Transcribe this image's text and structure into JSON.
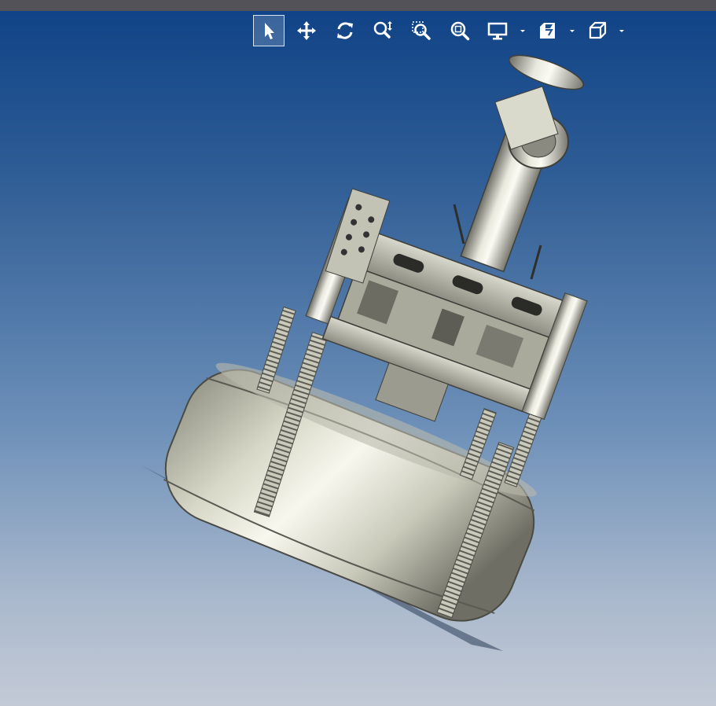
{
  "colors": {
    "background_top": "#0e4186",
    "background_bottom": "#c3cad6",
    "topbar": "#525258",
    "icon": "#ffffff"
  },
  "toolbar": {
    "tools": [
      {
        "name": "select",
        "icon": "arrow-pointer-icon",
        "active": true
      },
      {
        "name": "pan",
        "icon": "move-arrows-icon",
        "active": false
      },
      {
        "name": "rotate",
        "icon": "rotate-icon",
        "active": false
      },
      {
        "name": "zoom-in-out",
        "icon": "zoom-in-out-icon",
        "active": false
      },
      {
        "name": "zoom-area",
        "icon": "zoom-area-icon",
        "active": false
      },
      {
        "name": "zoom-to-fit",
        "icon": "zoom-fit-icon",
        "active": false
      },
      {
        "name": "display-style",
        "icon": "monitor-icon",
        "active": false,
        "dropdown": true
      },
      {
        "name": "section-view",
        "icon": "section-view-icon",
        "active": false,
        "dropdown": true
      },
      {
        "name": "view-orientation",
        "icon": "cube-icon",
        "active": false,
        "dropdown": true
      }
    ]
  }
}
